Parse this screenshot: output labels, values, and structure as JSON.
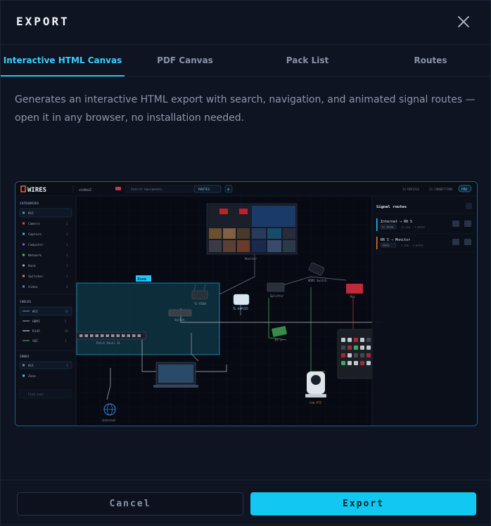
{
  "dialog": {
    "title": "EXPORT",
    "tabs": [
      {
        "label": "Interactive HTML Canvas",
        "active": true
      },
      {
        "label": "PDF Canvas",
        "active": false
      },
      {
        "label": "Pack List",
        "active": false
      },
      {
        "label": "Routes",
        "active": false
      }
    ],
    "description": "Generates an interactive HTML export with search, navigation, and animated signal routes — open it in any browser, no installation needed.",
    "cancel_label": "Cancel",
    "export_label": "Export",
    "accent_color": "#12c8f2"
  },
  "preview": {
    "brand": "WIRES",
    "project": "video2",
    "search_placeholder": "Search equipment…",
    "routes_btn": "ROUTES",
    "add_btn": "+",
    "counts": {
      "devices": "14 DEVICES",
      "connections": "23 CONNECTIONS",
      "badge": "PRO"
    },
    "categories_title": "CATEGORIES",
    "categories": [
      {
        "label": "All",
        "count": "",
        "color": "#7a8aa8"
      },
      {
        "label": "Camera",
        "count": "1",
        "color": "#e04a5a"
      },
      {
        "label": "Capture",
        "count": "1",
        "color": "#3ab8e0"
      },
      {
        "label": "Computer",
        "count": "1",
        "color": "#8a5ae0"
      },
      {
        "label": "Network",
        "count": "1",
        "color": "#4ac06a"
      },
      {
        "label": "Rack",
        "count": "1",
        "color": "#9aa4b5"
      },
      {
        "label": "Switcher",
        "count": "1",
        "color": "#e07a3a"
      },
      {
        "label": "Video",
        "count": "4",
        "color": "#3a8ae0"
      }
    ],
    "cables_title": "CABLES",
    "cables": [
      {
        "label": "All",
        "count": "18",
        "color": "#7a8aa8"
      },
      {
        "label": "HDMI",
        "count": "5",
        "color": "#9aa4b5"
      },
      {
        "label": "RJ45",
        "count": "10",
        "color": "#e0e6ee"
      },
      {
        "label": "SDI",
        "count": "1",
        "color": "#4ac06a"
      }
    ],
    "zones_title": "ZONES",
    "zones": [
      {
        "label": "All",
        "count": "1"
      },
      {
        "label": "Zone",
        "count": ""
      }
    ],
    "find_placeholder": "Find zone",
    "zone_label": "Zone",
    "devices": {
      "monitor": "Monitor",
      "hdmi_switch": "HDMI Switch",
      "splitter": "Splitter",
      "router": "TL-R500",
      "ap": "TL-EAP225",
      "switch": "Switch",
      "patch": "Patch Panel 24",
      "pi": "Pi 5",
      "recorder": "Rec",
      "ptz": "Cam PTZ",
      "internet": "Internet"
    },
    "signal_routes_title": "Signal routes",
    "routes": [
      {
        "title": "Internet → RR 5",
        "tag": "RJ 0450E",
        "meta": "· 11 seg · 1 paths",
        "color": "#1ec8ff"
      },
      {
        "title": "RR 5 → Monitor",
        "tag": "ISO81",
        "meta": "· 2 seg · 2 paths",
        "color": "#e07a3a"
      }
    ]
  }
}
